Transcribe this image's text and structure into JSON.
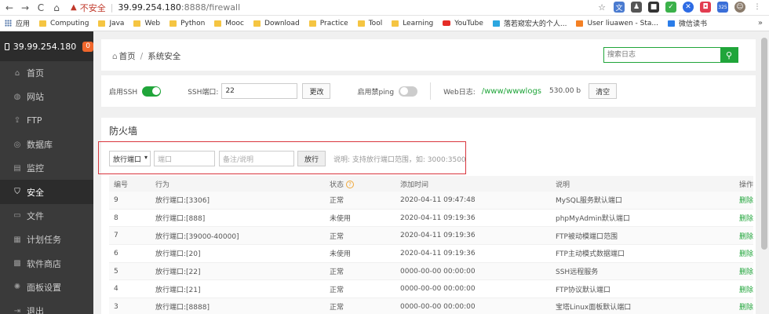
{
  "browser": {
    "insecure_label": "不安全",
    "url_host": "39.99.254.180",
    "url_path": ":8888/firewall",
    "bookmarks": [
      "应用",
      "Computing",
      "Java",
      "Web",
      "Python",
      "Mooc",
      "Download",
      "Practice",
      "Tool",
      "Learning",
      "YouTube",
      "落若窥宏大的个人...",
      "User liuawen - Sta...",
      "微信读书"
    ],
    "more": "»",
    "ext_badge": "325"
  },
  "sidebar": {
    "server": "39.99.254.180",
    "badge": "0",
    "items": [
      {
        "label": "首页",
        "icon": "home-icon"
      },
      {
        "label": "网站",
        "icon": "globe-icon"
      },
      {
        "label": "FTP",
        "icon": "ftp-icon"
      },
      {
        "label": "数据库",
        "icon": "database-icon"
      },
      {
        "label": "监控",
        "icon": "monitor-icon"
      },
      {
        "label": "安全",
        "icon": "shield-icon"
      },
      {
        "label": "文件",
        "icon": "folder-icon"
      },
      {
        "label": "计划任务",
        "icon": "calendar-icon"
      },
      {
        "label": "软件商店",
        "icon": "grid-icon"
      },
      {
        "label": "面板设置",
        "icon": "settings-icon"
      },
      {
        "label": "退出",
        "icon": "logout-icon"
      }
    ],
    "active_index": 5
  },
  "breadcrumb": {
    "home": "首页",
    "separator": "/",
    "current": "系统安全"
  },
  "search": {
    "placeholder": "搜索日志"
  },
  "ssh": {
    "enable_label": "启用SSH",
    "port_label": "SSH端口:",
    "port_value": "22",
    "change_button": "更改",
    "ping_label": "启用禁ping",
    "weblog_label": "Web日志:",
    "weblog_path": "/www/wwwlogs",
    "weblog_size": "530.00 b",
    "clear_button": "清空"
  },
  "firewall": {
    "title": "防火墙",
    "type_select": "放行端口",
    "port_placeholder": "端口",
    "note_placeholder": "备注/说明",
    "allow_button": "放行",
    "hint": "说明: 支持放行端口范围，如: 3000:3500"
  },
  "table": {
    "headers": [
      "编号",
      "行为",
      "状态",
      "添加时间",
      "说明",
      "操作"
    ],
    "rows": [
      {
        "id": "9",
        "action": "放行端口:[3306]",
        "status": "正常",
        "time": "2020-04-11 09:47:48",
        "desc": "MySQL服务默认端口",
        "op": "删除"
      },
      {
        "id": "8",
        "action": "放行端口:[888]",
        "status": "未使用",
        "time": "2020-04-11 09:19:36",
        "desc": "phpMyAdmin默认端口",
        "op": "删除"
      },
      {
        "id": "7",
        "action": "放行端口:[39000-40000]",
        "status": "正常",
        "time": "2020-04-11 09:19:36",
        "desc": "FTP被动模端口范围",
        "op": "删除"
      },
      {
        "id": "6",
        "action": "放行端口:[20]",
        "status": "未使用",
        "time": "2020-04-11 09:19:36",
        "desc": "FTP主动模式数据端口",
        "op": "删除"
      },
      {
        "id": "5",
        "action": "放行端口:[22]",
        "status": "正常",
        "time": "0000-00-00 00:00:00",
        "desc": "SSH远程服务",
        "op": "删除"
      },
      {
        "id": "4",
        "action": "放行端口:[21]",
        "status": "正常",
        "time": "0000-00-00 00:00:00",
        "desc": "FTP协议默认端口",
        "op": "删除"
      },
      {
        "id": "3",
        "action": "放行端口:[8888]",
        "status": "正常",
        "time": "0000-00-00 00:00:00",
        "desc": "宝塔Linux面板默认端口",
        "op": "删除"
      }
    ]
  },
  "colors": {
    "accent": "#20a53a",
    "sidebar": "#3a3a3a",
    "highlight": "#d9363e"
  }
}
